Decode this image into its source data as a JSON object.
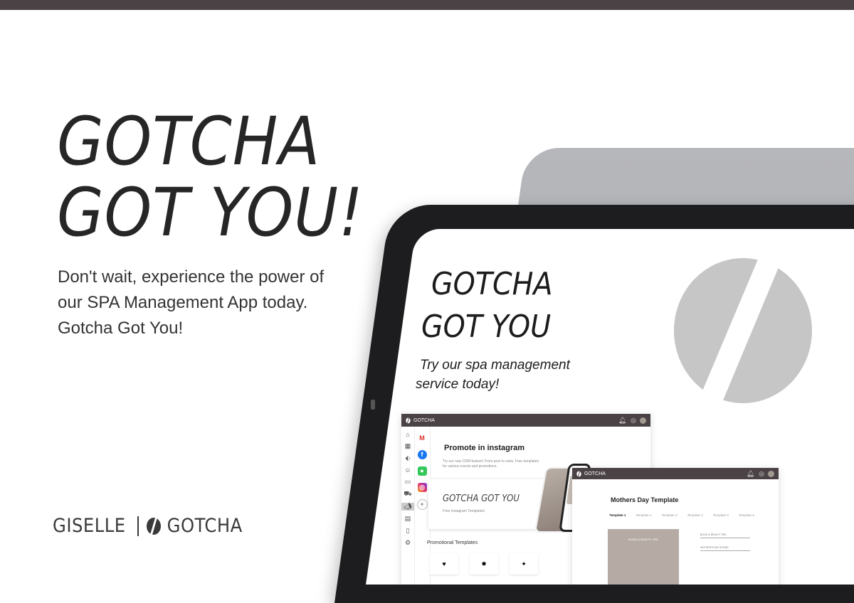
{
  "hero": {
    "headline_line1": "GOTCHA",
    "headline_line2": "GOT YOU!",
    "tagline": "Don't wait, experience the power of our SPA Management App today. Gotcha Got You!"
  },
  "brand": {
    "name_left": "GISELLE",
    "name_right": "GOTCHA"
  },
  "mockup": {
    "title_line1": "GOTCHA",
    "title_line2": "GOT YOU",
    "subtitle_line1": "Try our spa management",
    "subtitle_line2": "service today!",
    "app_window": {
      "bar_title": "GOTCHA",
      "promo_title": "Promote in instagram",
      "promo_desc": "Try our new CRM feature! From post to reels. Free templates for various events and promotions.",
      "card_title": "GOTCHA GOT YOU",
      "card_subtitle": "Free Instagram Templates!",
      "section_label": "Promotional Templates"
    },
    "template_window": {
      "bar_title": "GOTCHA",
      "title": "Mothers Day Template",
      "tabs": [
        "Template 1",
        "Template 2",
        "Template 3",
        "Template 4",
        "Template 5",
        "Template 6"
      ],
      "image_caption": "BLING & BEAUTY SPA",
      "field1": "BLING & BEAUTY SPA",
      "field2": "MOTHER'S DAY SOUND"
    }
  },
  "colors": {
    "topbar": "#4b4246",
    "text_dark": "#262626",
    "device_back": "#b6b7bb",
    "device_frame": "#1d1d1f"
  }
}
